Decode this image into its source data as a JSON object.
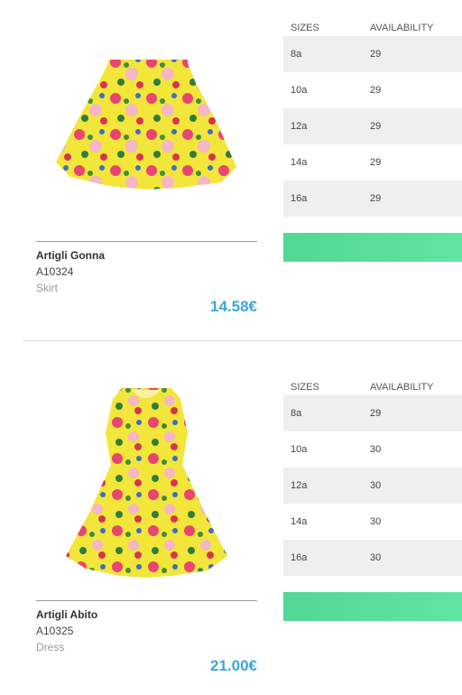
{
  "colors": {
    "price": "#3aa6d8",
    "button": "#5bdb9c",
    "row_shade": "#efefef"
  },
  "table_headers": {
    "sizes": "SIZES",
    "availability": "AVAILABILITY"
  },
  "products": [
    {
      "image": "yellow-floral-skirt",
      "name": "Artigli Gonna",
      "code": "A10324",
      "type": "Skirt",
      "price": "14.58€",
      "sizes": [
        {
          "size": "8a",
          "availability": "29"
        },
        {
          "size": "10a",
          "availability": "29"
        },
        {
          "size": "12a",
          "availability": "29"
        },
        {
          "size": "14a",
          "availability": "29"
        },
        {
          "size": "16a",
          "availability": "29"
        }
      ]
    },
    {
      "image": "yellow-floral-dress",
      "name": "Artigli Abito",
      "code": "A10325",
      "type": "Dress",
      "price": "21.00€",
      "sizes": [
        {
          "size": "8a",
          "availability": "29"
        },
        {
          "size": "10a",
          "availability": "30"
        },
        {
          "size": "12a",
          "availability": "30"
        },
        {
          "size": "14a",
          "availability": "30"
        },
        {
          "size": "16a",
          "availability": "30"
        }
      ]
    }
  ]
}
